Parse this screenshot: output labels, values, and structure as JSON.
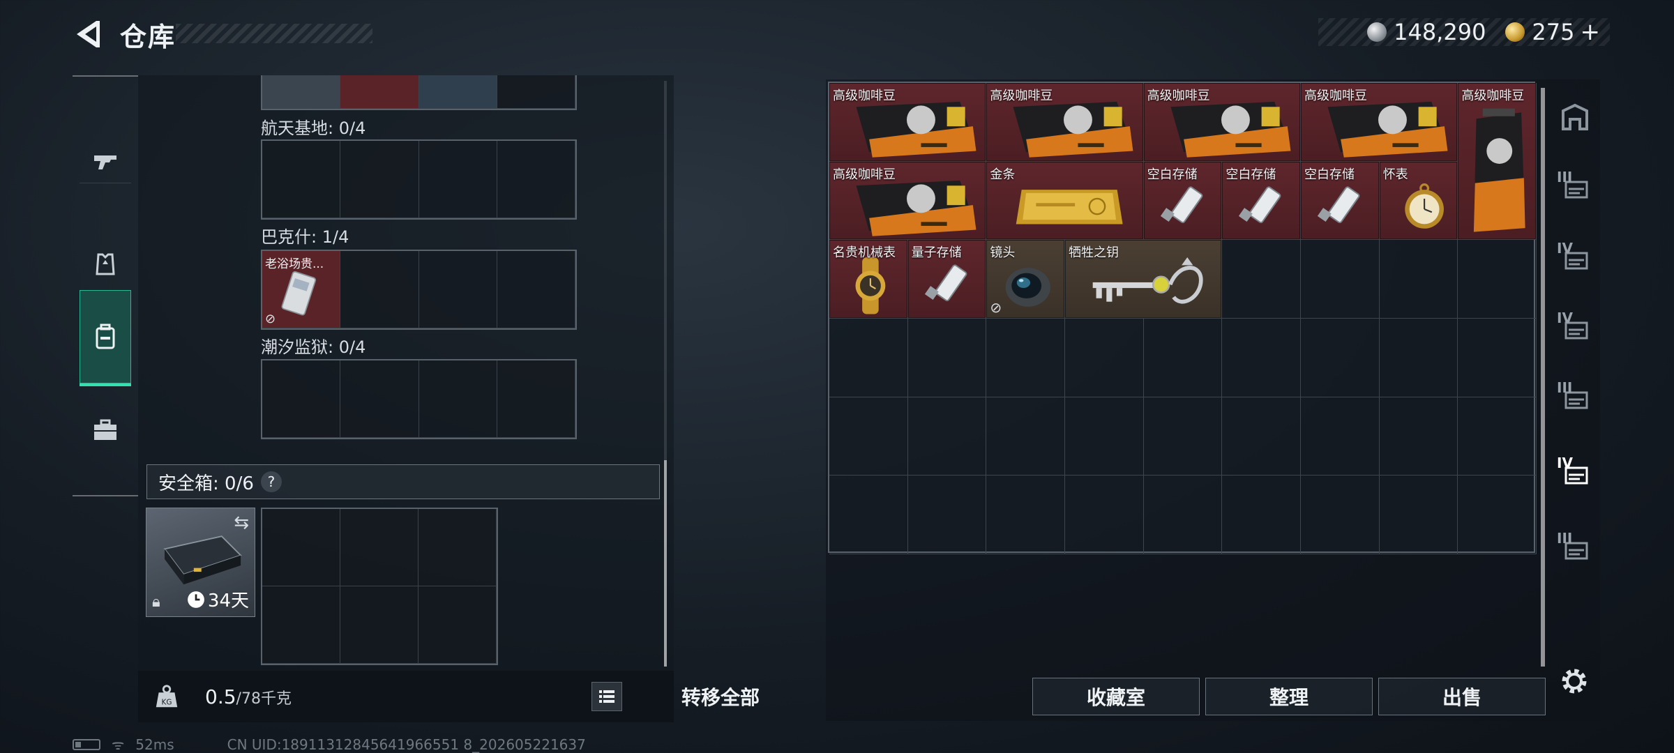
{
  "header": {
    "title": "仓库"
  },
  "currency": {
    "silver": "148,290",
    "gold": "275",
    "gold_plus": "+"
  },
  "left_nav": {
    "items": [
      "gun-icon",
      "armor-icon",
      "backpack-icon",
      "case-icon"
    ],
    "active": 2
  },
  "sections": [
    {
      "label": "航天基地: 0/4"
    },
    {
      "label": "巴克什: 1/4",
      "item_name": "老浴场贵..."
    },
    {
      "label": "潮汐监狱: 0/4"
    }
  ],
  "safebox": {
    "label": "安全箱: 0/6",
    "help": "?",
    "duration": "34天",
    "swap": "⇆"
  },
  "weight": {
    "current": "0.5",
    "max": "/78千克"
  },
  "buttons": {
    "transfer_all": "转移全部",
    "collection": "收藏室",
    "organize": "整理",
    "sell": "出售"
  },
  "stash_items": [
    {
      "name": "高级咖啡豆"
    },
    {
      "name": "高级咖啡豆"
    },
    {
      "name": "高级咖啡豆"
    },
    {
      "name": "高级咖啡豆"
    },
    {
      "name": "高级咖啡豆"
    },
    {
      "name": "高级咖啡豆"
    },
    {
      "name": "金条"
    },
    {
      "name": "空白存储"
    },
    {
      "name": "空白存储"
    },
    {
      "name": "空白存储"
    },
    {
      "name": "怀表"
    },
    {
      "name": "名贵机械表"
    },
    {
      "name": "量子存储"
    },
    {
      "name": "镜头"
    },
    {
      "name": "牺牲之钥"
    }
  ],
  "right_nav": {
    "levels": [
      "",
      "III",
      "IV",
      "IV",
      "III",
      "IV",
      "III"
    ],
    "active": 5
  },
  "status": {
    "ping": "52ms",
    "uid": "CN UID:18911312845641966551 8_202605221637"
  }
}
